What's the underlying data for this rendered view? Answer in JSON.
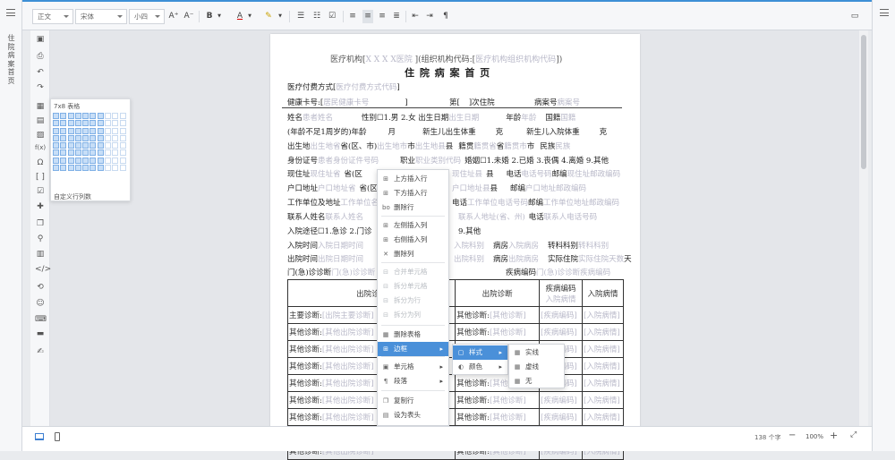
{
  "left_nav": {
    "vertical_title": "住院病案首页"
  },
  "toolbar": {
    "style_select": "正文",
    "font_select": "宋体",
    "size_select": "小四",
    "grow_font": "A⁺",
    "shrink_font": "A⁻",
    "bold": "B",
    "font_color": "A"
  },
  "document": {
    "header_line": {
      "prefix": "医疗机构[",
      "org_ph": "X X X X医院",
      "mid": " ](组织机构代码:[",
      "code_ph": "医疗机构组织机构代码",
      "suffix": "])"
    },
    "title": "住 院 病 案 首 页",
    "payment_label": "医疗付费方式[",
    "payment_ph": "医疗付费方式代码",
    "payment_close": "]",
    "health_card_label": "健康卡号:[",
    "health_card_ph": "居民健康卡号",
    "health_card_close": "]",
    "admit_times_a": "第[",
    "admit_times_b": "]次住院",
    "case_no_label": "病案号",
    "case_no_ph": "病案号",
    "name_label": "姓名",
    "name_ph": "患者姓名",
    "gender_label": "性别☐1.男 2.女 出生日期",
    "birth_ph": "出生日期",
    "age_label": "年龄",
    "age_ph": "年龄",
    "nationality_label": "国籍",
    "nationality_ph": "国籍",
    "infant_age": "(年龄不足1周岁的)年龄",
    "month": "月",
    "newborn_weight": "新生儿出生体重",
    "gram1": "克",
    "newborn_admit_weight": "新生儿入院体重",
    "gram2": "克",
    "birthplace_label": "出生地",
    "birth_prov_ph": "出生地省",
    "prov_text": "省(区、市)",
    "birth_city_ph": "出生地市",
    "city_text": "市",
    "birth_county_ph": "出生地县",
    "county_text": "县",
    "native_label": "籍贯",
    "native_prov_ph": "籍贯省",
    "native_prov": "省",
    "native_city_ph": "籍贯市",
    "native_city": "市",
    "ethnic_label": "民族",
    "ethnic_ph": "民族",
    "id_label": "身份证号",
    "id_ph": "患者身份证件号码",
    "job_label": "职业",
    "job_ph": "职业类别代码",
    "marital_label": "婚姻☐1.未婚 2.已婚 3.丧偶 4.离婚 9.其他",
    "current_addr": "现住址",
    "current_addr_ph": "现住址省",
    "current_prov": "省(区",
    "current_county_ph": "现住址县",
    "county2": "县",
    "phone_label": "电话",
    "phone_ph": "电话号码",
    "zip_label": "邮编",
    "zip_ph": "现住址邮政编码",
    "household_addr": "户口地址",
    "household_ph": "户口地址省",
    "household_prov": "省(区",
    "household_county_ph": "户口地址县",
    "county3": "县",
    "zip2_label": "邮编",
    "zip2_ph": "户口地址邮政编码",
    "work_label": "工作单位及地址",
    "work_ph": "工作单位名称",
    "work_phone_label": "电话",
    "work_phone_ph": "工作单位电话号码",
    "work_zip_label": "邮编",
    "work_zip_ph": "工作单位地址邮政编码",
    "contact_label": "联系人姓名",
    "contact_ph": "联系人姓名",
    "contact_addr_ph": "联系人地址(省、州)",
    "contact_phone_label": "电话",
    "contact_phone_ph": "联系人电话号码",
    "route_label": "入院途径☐1.急诊 2.门诊",
    "route_other": "9.其他",
    "admit_time": "入院时间",
    "admit_time_ph": "入院日期时间",
    "admit_dept_ph": "入院科别",
    "ward1": "病房",
    "ward1_ph": "入院病房",
    "transfer_label": "转科科别",
    "transfer_ph": "转科科别",
    "discharge_time": "出院时间",
    "discharge_time_ph": "出院日期时间",
    "discharge_dept_ph": "出院科别",
    "ward2": "病房",
    "ward2_ph": "出院病房",
    "days_label": "实际住院",
    "days_ph": "实际住院天数",
    "day_unit": "天",
    "er_diag": "门(急)诊诊断",
    "er_diag_ph": "门(急)诊诊断",
    "disease_code": "疾病编码",
    "disease_code_ph": "门(急)诊诊断疾病编码"
  },
  "diag_table": {
    "headers": [
      "出院诊断",
      "出院诊断",
      "疾病编码",
      "入院病情"
    ],
    "header_ph": "入院病情",
    "rows": [
      {
        "label": "主要诊断:",
        "ph": "出院主要诊断",
        "label2": "其他诊断:",
        "ph2": "其他诊断",
        "code_ph": "疾病编码",
        "cond_ph": "入院病情"
      },
      {
        "label": "其他诊断:",
        "ph": "其他出院诊断",
        "label2": "其他诊断:",
        "ph2": "其他诊断",
        "code_ph": "疾病编码",
        "cond_ph": "入院病情"
      },
      {
        "label": "其他诊断:",
        "ph": "其他出院诊断",
        "label2": "其他诊断:",
        "ph2": "其他诊断",
        "code_ph": "疾病编码",
        "cond_ph": "入院病情"
      },
      {
        "label": "其他诊断:",
        "ph": "其他出院诊断",
        "label2": "其他诊断:",
        "ph2": "其他诊断",
        "code_ph": "疾病编码",
        "cond_ph": "入院病情"
      },
      {
        "label": "其他诊断:",
        "ph": "其他出院诊断",
        "label2": "其他诊断:",
        "ph2": "其他诊断",
        "code_ph": "疾病编码",
        "cond_ph": "入院病情"
      },
      {
        "label": "其他诊断:",
        "ph": "其他出院诊断",
        "label2": "其他诊断:",
        "ph2": "其他诊断",
        "code_ph": "疾病编码",
        "cond_ph": "入院病情"
      },
      {
        "label": "其他诊断:",
        "ph": "其他出院诊断",
        "label2": "其他诊断:",
        "ph2": "其他诊断",
        "code_ph": "疾病编码",
        "cond_ph": "入院病情"
      },
      {
        "label": "其他诊断:",
        "ph": "其他出院诊断",
        "label2": "其他诊断:",
        "ph2": "其他诊断",
        "code_ph": "疾病编码",
        "cond_ph": "入院病情"
      },
      {
        "label": "其他诊断:",
        "ph": "其他出院诊断",
        "label2": "其他诊断:",
        "ph2": "其他诊断",
        "code_ph": "疾病编码",
        "cond_ph": "入院病情"
      }
    ]
  },
  "table_picker": {
    "title": "7x8 表格",
    "custom": "自定义行列数",
    "cols": 10,
    "rows": 8,
    "sel_cols": 7,
    "sel_rows": 8
  },
  "context_menu": {
    "items": [
      {
        "label": "上方插入行",
        "icon": "insert-row-above-icon",
        "glyph": "⊞",
        "disabled": false
      },
      {
        "label": "下方插入行",
        "icon": "insert-row-below-icon",
        "glyph": "⊞",
        "disabled": false
      },
      {
        "label": "删除行",
        "icon": "delete-row-icon",
        "glyph": "bo",
        "disabled": false
      },
      {
        "label": "左侧插入列",
        "icon": "insert-col-left-icon",
        "glyph": "⊞",
        "disabled": false
      },
      {
        "label": "右侧插入列",
        "icon": "insert-col-right-icon",
        "glyph": "⊞",
        "disabled": false
      },
      {
        "label": "删除列",
        "icon": "delete-col-icon",
        "glyph": "✕",
        "disabled": false
      },
      {
        "label": "合并单元格",
        "icon": "merge-cells-icon",
        "glyph": "⊟",
        "disabled": true
      },
      {
        "label": "拆分单元格",
        "icon": "split-cells-icon",
        "glyph": "⊟",
        "disabled": true
      },
      {
        "label": "拆分为行",
        "icon": "split-rows-icon",
        "glyph": "⊟",
        "disabled": true
      },
      {
        "label": "拆分为列",
        "icon": "split-cols-icon",
        "glyph": "⊟",
        "disabled": true
      },
      {
        "label": "删除表格",
        "icon": "delete-table-icon",
        "glyph": "▦",
        "disabled": false
      },
      {
        "label": "边框",
        "icon": "border-icon",
        "glyph": "⊞",
        "disabled": false,
        "submenu": true,
        "active": true
      },
      {
        "label": "单元格",
        "icon": "cell-icon",
        "glyph": "▣",
        "disabled": false,
        "submenu": true
      },
      {
        "label": "段落",
        "icon": "paragraph-icon",
        "glyph": "¶",
        "disabled": false,
        "submenu": true
      },
      {
        "label": "复制行",
        "icon": "copy-row-icon",
        "glyph": "❐",
        "disabled": false
      },
      {
        "label": "设为表头",
        "icon": "set-header-icon",
        "glyph": "▤",
        "disabled": false
      }
    ],
    "sub1": [
      {
        "label": "样式",
        "active": true
      },
      {
        "label": "颜色",
        "active": false
      }
    ],
    "sub2": [
      {
        "label": "实线"
      },
      {
        "label": "虚线"
      },
      {
        "label": "无"
      }
    ]
  },
  "status": {
    "word_count": "138 个字",
    "zoom": "100%"
  }
}
